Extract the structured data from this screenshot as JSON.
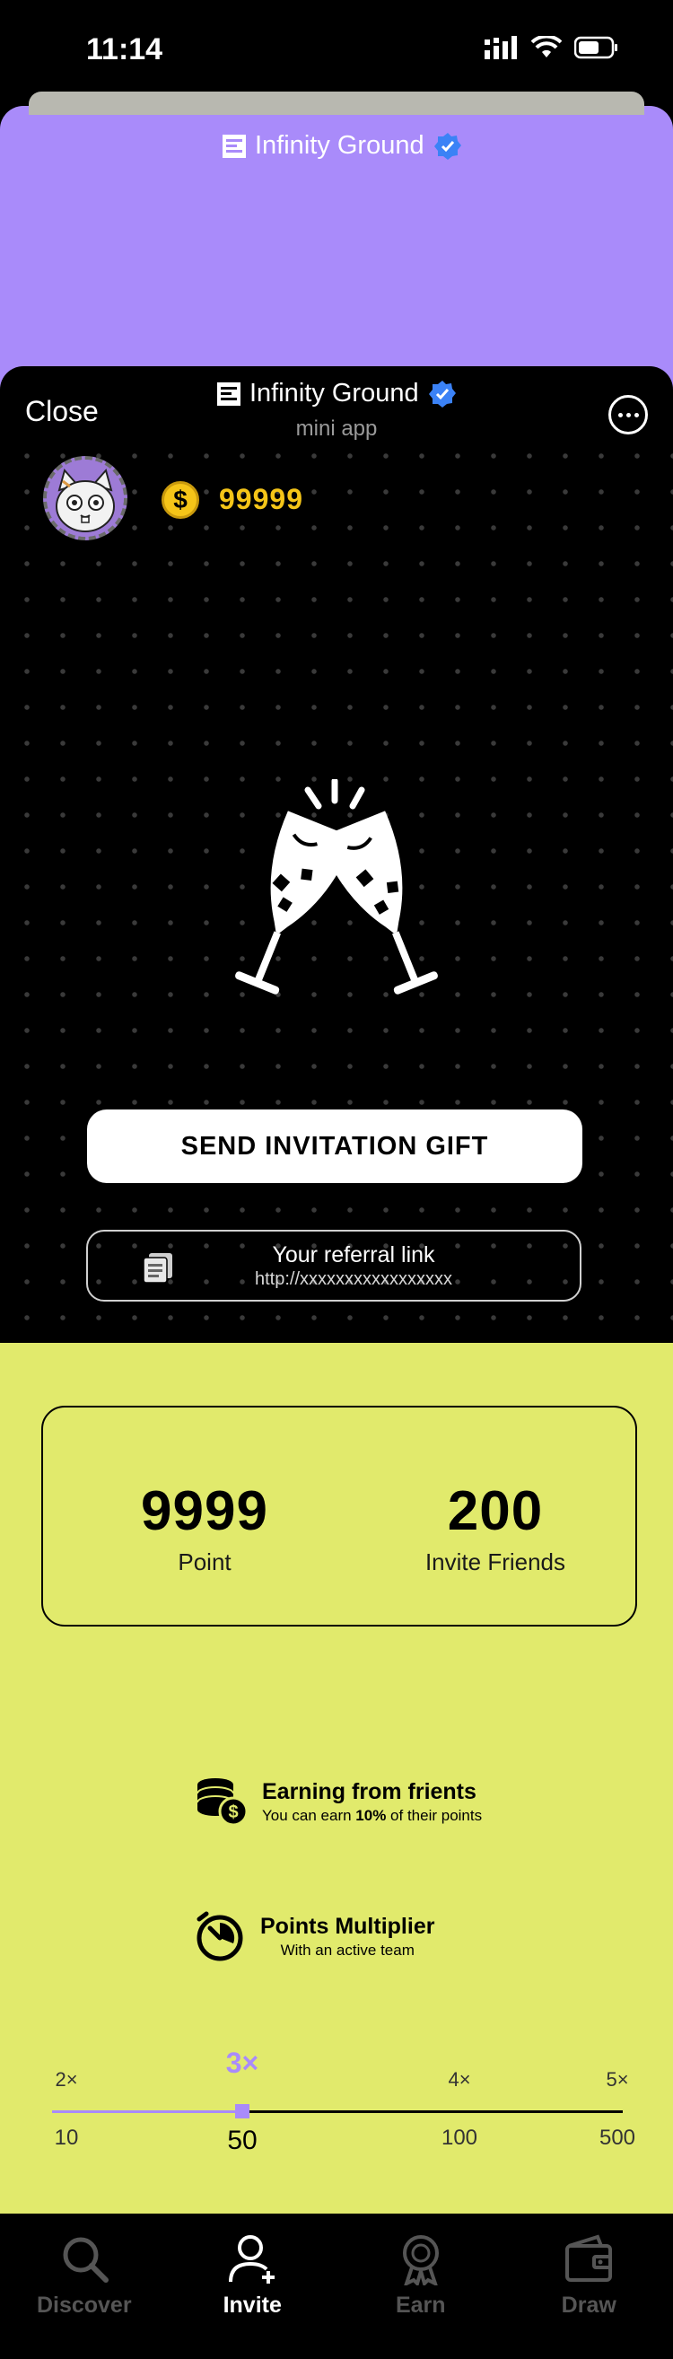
{
  "status_bar": {
    "time": "11:14"
  },
  "background_sheet": {
    "brand_name": "Infinity Ground"
  },
  "mini_app": {
    "close_label": "Close",
    "brand_name": "Infinity Ground",
    "subtitle": "mini app",
    "coin_symbol": "$",
    "coin_balance": "99999",
    "send_gift_label": "SEND INVITATION GIFT",
    "referral_label": "Your referral link",
    "referral_url": "http://xxxxxxxxxxxxxxxxx"
  },
  "stats": {
    "points_value": "9999",
    "points_label": "Point",
    "friends_value": "200",
    "friends_label": "Invite Friends"
  },
  "features": {
    "earning_title": "Earning from frients",
    "earning_desc_prefix": "You can earn ",
    "earning_desc_percent": "10%",
    "earning_desc_suffix": " of their points",
    "multiplier_title": "Points Multiplier",
    "multiplier_desc": "With an active team"
  },
  "multiplier_slider": {
    "steps": [
      {
        "multiplier": "2×",
        "threshold": "10"
      },
      {
        "multiplier": "3×",
        "threshold": "50"
      },
      {
        "multiplier": "4×",
        "threshold": "100"
      },
      {
        "multiplier": "5×",
        "threshold": "500"
      }
    ],
    "active_index": 1
  },
  "tab_bar": {
    "discover": "Discover",
    "invite": "Invite",
    "earn": "Earn",
    "draw": "Draw",
    "active": "invite"
  },
  "colors": {
    "accent_purple": "#a98bfa",
    "lime_background": "#e1ea6c",
    "coin_gold": "#f5c518",
    "verified_blue": "#3b82f6"
  }
}
